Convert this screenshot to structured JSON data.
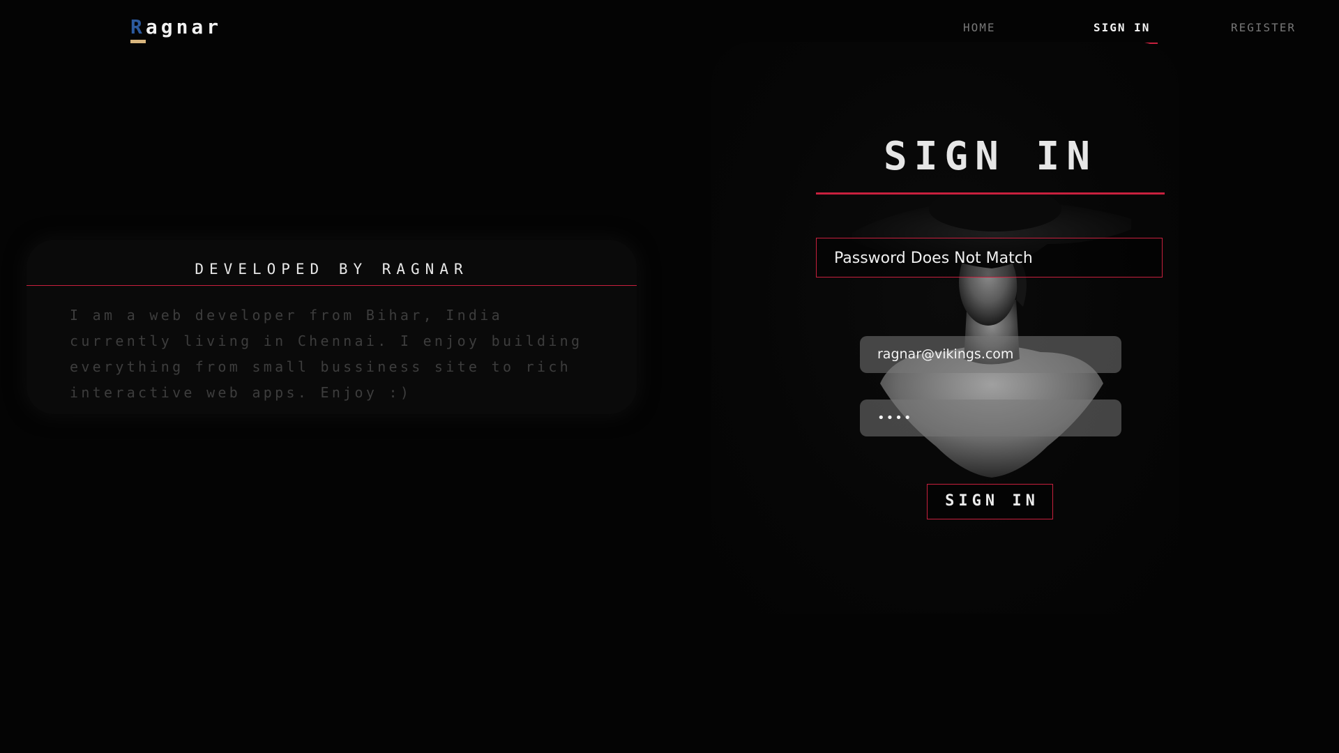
{
  "navbar": {
    "logo_first_letter": "R",
    "logo_rest": "agnar",
    "links": {
      "home": "HOME",
      "signin": "SIGN IN",
      "register": "REGISTER"
    }
  },
  "about": {
    "title": "DEVELOPED BY RAGNAR",
    "text": "I am a web developer from Bihar, India currently living in Chennai. I enjoy building everything from small bussiness site to rich interactive web apps. Enjoy :)"
  },
  "signin": {
    "heading": "SIGN IN",
    "error_message": "Password Does Not Match",
    "email_value": "ragnar@vikings.com",
    "password_value": "••••",
    "button_label": "SIGN IN"
  },
  "colors": {
    "background": "#040404",
    "accent_red": "#c8203e",
    "logo_blue": "#2c5a9e",
    "logo_gold": "#d9b67e"
  }
}
